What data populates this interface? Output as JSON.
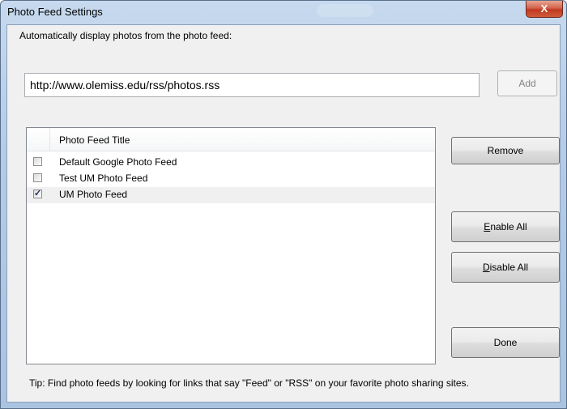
{
  "window": {
    "title": "Photo Feed Settings",
    "close_label": "X"
  },
  "form": {
    "instruction": "Automatically display photos from the photo feed:",
    "url_value": "http://www.olemiss.edu/rss/photos.rss",
    "add_label": "Add"
  },
  "list": {
    "column_header": "Photo Feed Title",
    "rows": [
      {
        "label": "Default Google Photo Feed",
        "checked": false
      },
      {
        "label": "Test UM Photo Feed",
        "checked": false
      },
      {
        "label": "UM Photo Feed",
        "checked": true
      }
    ]
  },
  "buttons": {
    "remove": "Remove",
    "enable_all": "Enable All",
    "disable_all": "Disable All",
    "done": "Done"
  },
  "tip": "Tip: Find photo feeds by looking for links that say \"Feed\" or \"RSS\" on your favorite photo sharing sites.",
  "colors": {
    "frame": "#b9cfe8",
    "client": "#f0f0f0",
    "close_button": "#c74a30",
    "selected_row": "#f0f0f0"
  }
}
